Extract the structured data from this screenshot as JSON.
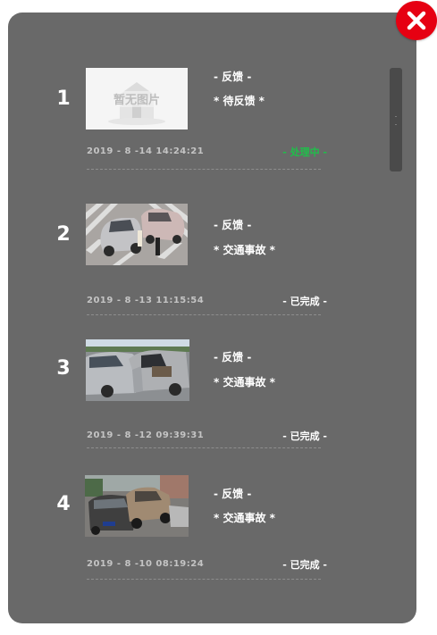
{
  "no_image_text": "暂无图片",
  "items": [
    {
      "index": "1",
      "line1": "- 反馈 -",
      "line2": "* 待反馈 *",
      "time": "2019 - 8 -14 14:24:21",
      "status": "- 处理中 -",
      "image": "none"
    },
    {
      "index": "2",
      "line1": "- 反馈 -",
      "line2": "* 交通事故 *",
      "time": "2019 - 8 -13 11:15:54",
      "status": "- 已完成 -",
      "image": "crash-crosswalk"
    },
    {
      "index": "3",
      "line1": "- 反馈 -",
      "line2": "* 交通事故 *",
      "time": "2019 - 8 -12 09:39:31",
      "status": "- 已完成 -",
      "image": "crash-door"
    },
    {
      "index": "4",
      "line1": "- 反馈 -",
      "line2": "* 交通事故 *",
      "time": "2019 - 8 -10 08:19:24",
      "status": "- 已完成 -",
      "image": "crash-pileup"
    }
  ],
  "colors": {
    "panel": "#696969",
    "close": "#e60012",
    "pending": "#1fbf4a",
    "done": "#ffffff"
  },
  "icons": {
    "close": "close-icon"
  }
}
